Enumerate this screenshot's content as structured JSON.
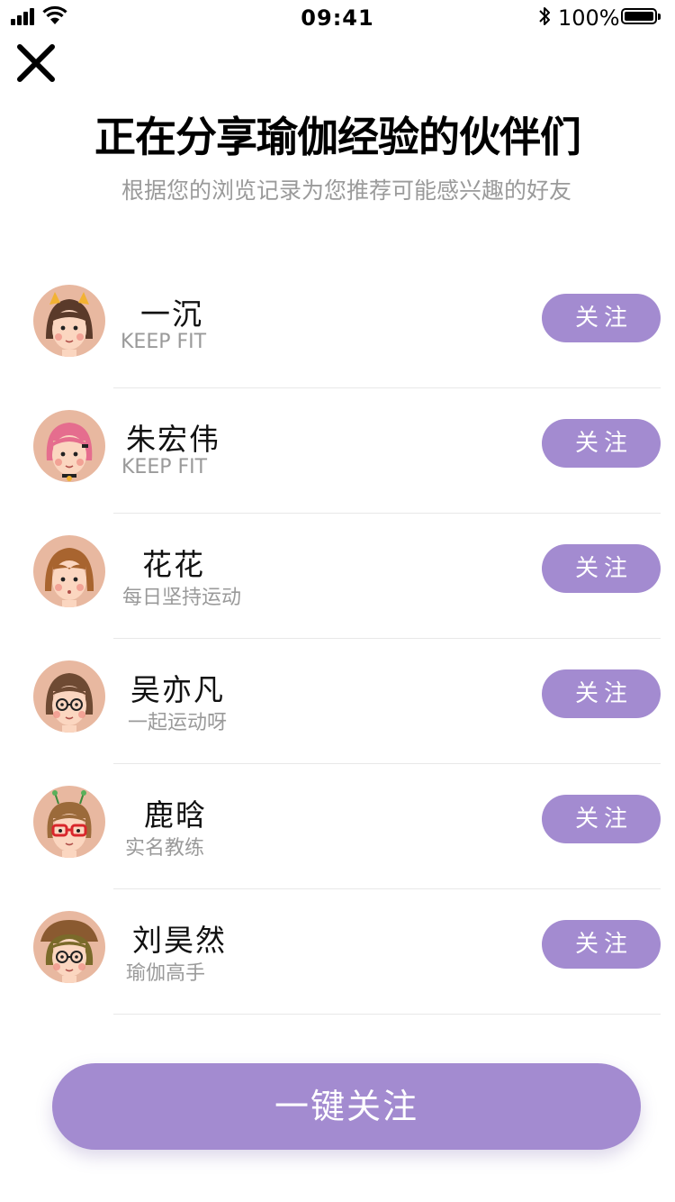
{
  "status_bar": {
    "time": "09:41",
    "battery": "100%",
    "icons": [
      "signal-icon",
      "wifi-icon",
      "bluetooth-icon",
      "battery-icon"
    ]
  },
  "header": {
    "close_icon": "close-icon",
    "title": "正在分享瑜伽经验的伙伴们",
    "subtitle": "根据您的浏览记录为您推荐可能感兴趣的好友"
  },
  "users": [
    {
      "name": "一沉",
      "desc": "KEEP FIT",
      "button": "关注",
      "hair": "#5a3a2a",
      "accent": "#f2b233"
    },
    {
      "name": "朱宏伟",
      "desc": "KEEP FIT",
      "button": "关注",
      "hair": "#e56d8e",
      "accent": "#222222"
    },
    {
      "name": "花花",
      "desc": "每日坚持运动",
      "button": "关注",
      "hair": "#a8642f",
      "accent": "#a8642f"
    },
    {
      "name": "吴亦凡",
      "desc": "一起运动呀",
      "button": "关注",
      "hair": "#6e4a33",
      "accent": "#222222"
    },
    {
      "name": "鹿晗",
      "desc": "实名教练",
      "button": "关注",
      "hair": "#9b6a3a",
      "accent": "#d9262b"
    },
    {
      "name": "刘昊然",
      "desc": "瑜伽高手",
      "button": "关注",
      "hair": "#7a6a2a",
      "accent": "#8a5a30"
    }
  ],
  "footer": {
    "follow_all": "一键关注"
  },
  "colors": {
    "accent": "#a38bd0",
    "avatar_bg": "#e8b8a0",
    "muted_text": "#9a9a9a"
  }
}
